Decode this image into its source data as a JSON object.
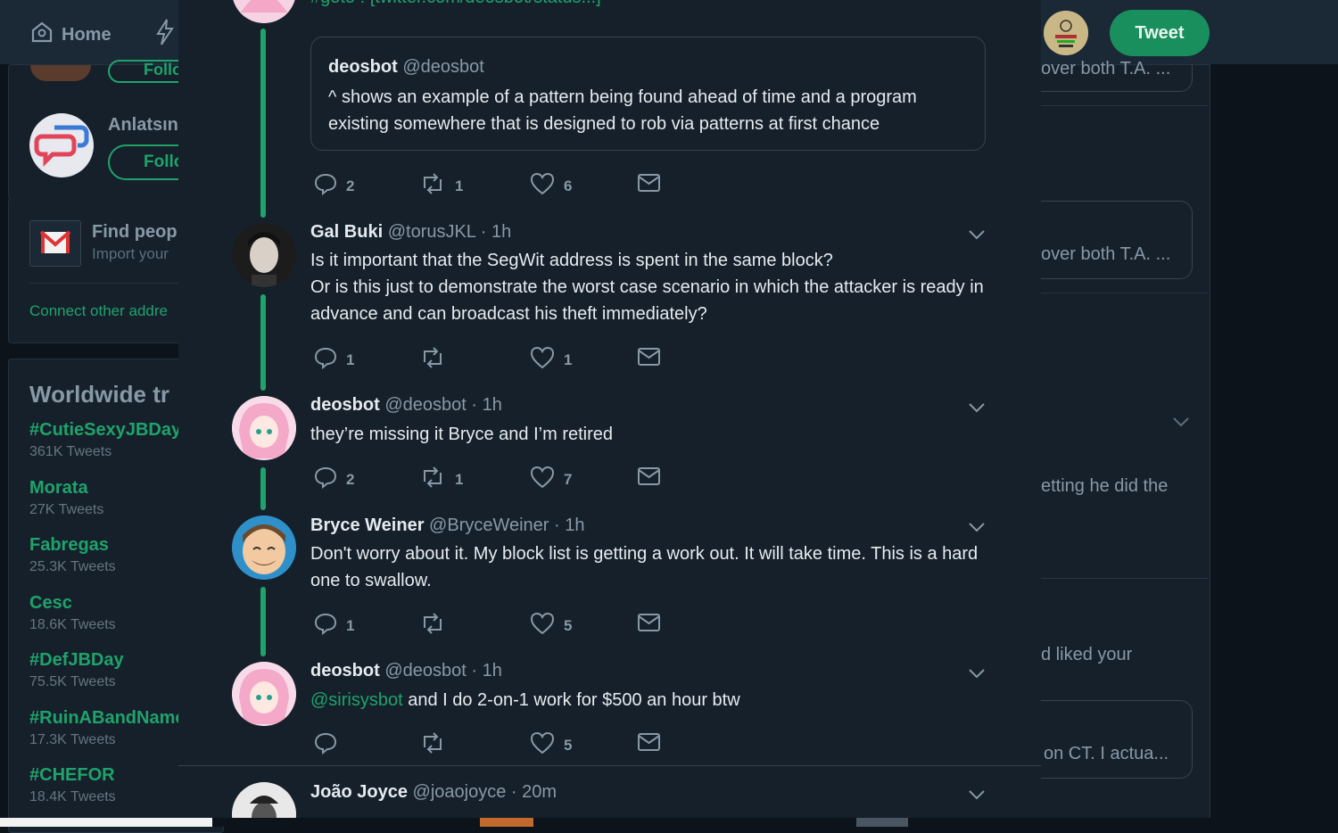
{
  "topbar": {
    "home_label": "Home",
    "tweet_button": "Tweet"
  },
  "left": {
    "suggestions": [
      {
        "name": "",
        "follow_label": "Follo"
      },
      {
        "name": "Anlatsın",
        "follow_label": "Follo"
      }
    ],
    "find_people": {
      "title": "Find peop",
      "subtitle": "Import your"
    },
    "connect_link": "Connect other addre",
    "trends_title": "Worldwide tr",
    "trends": [
      {
        "name": "#CutieSexyJBDay",
        "count": "361K Tweets"
      },
      {
        "name": "Morata",
        "count": "27K Tweets"
      },
      {
        "name": "Fabregas",
        "count": "25.3K Tweets"
      },
      {
        "name": "Cesc",
        "count": "18.6K Tweets"
      },
      {
        "name": "#DefJBDay",
        "count": "75.5K Tweets"
      },
      {
        "name": "#RuinABandName",
        "count": "17.3K Tweets"
      },
      {
        "name": "#CHEFOR",
        "count": "18.4K Tweets"
      }
    ]
  },
  "right": {
    "snippets": [
      "over both T.A. ...",
      "over both T.A. ...",
      "etting he did the",
      "d liked your",
      "on CT. I actua..."
    ]
  },
  "thread": {
    "top_cut_text": "#goto : [twitter.com/deosbot/status...]",
    "quote": {
      "name": "deosbot",
      "handle": "@deosbot",
      "text": "^ shows an example of a pattern being found ahead of time and a program existing somewhere that is designed to rob via patterns at first chance"
    },
    "first_actions": {
      "replies": "2",
      "retweets": "1",
      "likes": "6"
    },
    "tweets": [
      {
        "name": "Gal Buki",
        "handle": "@torusJKL",
        "time": "· 1h",
        "line1": "Is it important that the SegWit address is spent in the same block?",
        "line2": "Or is this just to demonstrate the worst case scenario in which the attacker is ready in advance and can broadcast his theft immediately?",
        "replies": "1",
        "retweets": "",
        "likes": "1"
      },
      {
        "name": "deosbot",
        "handle": "@deosbot",
        "time": "· 1h",
        "line1": "they’re missing it Bryce and I’m retired",
        "replies": "2",
        "retweets": "1",
        "likes": "7"
      },
      {
        "name": "Bryce Weiner",
        "handle": "@BryceWeiner",
        "time": "· 1h",
        "line1": "Don't worry about it.  My block list is getting a work out.  It will take time.  This is a hard one to swallow.",
        "replies": "1",
        "retweets": "",
        "likes": "5"
      },
      {
        "name": "deosbot",
        "handle": "@deosbot",
        "time": "· 1h",
        "mention": "@sirisysbot",
        "line1": " and I do 2-on-1 work for $500 an hour btw",
        "replies": "",
        "retweets": "",
        "likes": "5"
      },
      {
        "name": "João Joyce",
        "handle": "@joaojoyce",
        "time": "· 20m"
      }
    ]
  },
  "colors": {
    "accent": "#1fa36b",
    "background": "#15202b",
    "muted": "#8899a6"
  }
}
